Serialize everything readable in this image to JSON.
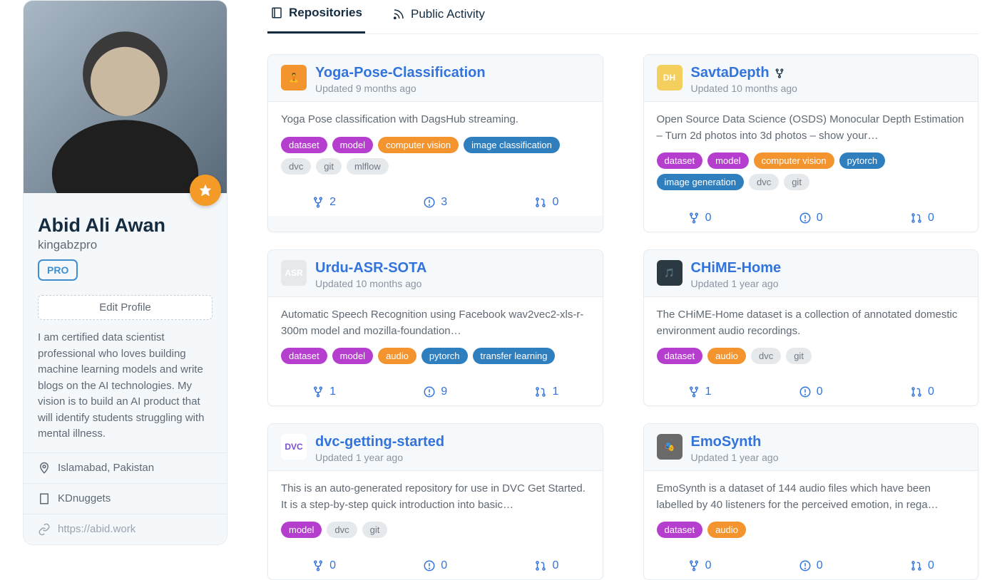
{
  "profile": {
    "name": "Abid Ali Awan",
    "username": "kingabzpro",
    "badge": "PRO",
    "edit_label": "Edit Profile",
    "bio": "I am certified data scientist professional who loves building machine learning models and write blogs on the AI technologies. My vision is to build an AI product that will identify students struggling with mental illness.",
    "location": "Islamabad, Pakistan",
    "org": "KDnuggets",
    "website": "https://abid.work"
  },
  "tabs": {
    "repositories": "Repositories",
    "activity": "Public Activity"
  },
  "tag_colors": {
    "dataset": "purple",
    "model": "purple",
    "computer vision": "orange",
    "image classification": "blue",
    "dvc": "grey",
    "git": "grey",
    "mlflow": "grey",
    "pytorch": "blue",
    "image generation": "blue",
    "audio": "orange",
    "transfer learning": "blue"
  },
  "repos": [
    {
      "title": "Yoga-Pose-Classification",
      "updated": "Updated 9 months ago",
      "fork": false,
      "icon_bg": "#f4942e",
      "icon_text": "🧘",
      "desc": "Yoga Pose classification with DagsHub streaming.",
      "tags": [
        "dataset",
        "model",
        "computer vision",
        "image classification",
        "dvc",
        "git",
        "mlflow"
      ],
      "stats": {
        "forks": "2",
        "issues": "3",
        "prs": "0"
      }
    },
    {
      "title": "SavtaDepth",
      "updated": "Updated 10 months ago",
      "fork": true,
      "icon_bg": "#f4cf5e",
      "icon_text": "DH",
      "desc": "Open Source Data Science (OSDS) Monocular Depth Estimation – Turn 2d photos into 3d photos – show your…",
      "tags": [
        "dataset",
        "model",
        "computer vision",
        "pytorch",
        "image generation",
        "dvc",
        "git"
      ],
      "stats": {
        "forks": "0",
        "issues": "0",
        "prs": "0"
      }
    },
    {
      "title": "Urdu-ASR-SOTA",
      "updated": "Updated 10 months ago",
      "fork": false,
      "icon_bg": "#e6e9ec",
      "icon_text": "ASR",
      "desc": "Automatic Speech Recognition using Facebook wav2vec2-xls-r-300m model and mozilla-foundation…",
      "tags": [
        "dataset",
        "model",
        "audio",
        "pytorch",
        "transfer learning"
      ],
      "stats": {
        "forks": "1",
        "issues": "9",
        "prs": "1"
      }
    },
    {
      "title": "CHiME-Home",
      "updated": "Updated 1 year ago",
      "fork": false,
      "icon_bg": "#2b3a42",
      "icon_text": "🎵",
      "desc": "The CHiME-Home dataset is a collection of annotated domestic environment audio recordings.",
      "tags": [
        "dataset",
        "audio",
        "dvc",
        "git"
      ],
      "stats": {
        "forks": "1",
        "issues": "0",
        "prs": "0"
      }
    },
    {
      "title": "dvc-getting-started",
      "updated": "Updated 1 year ago",
      "fork": false,
      "icon_bg": "#fff",
      "icon_text": "DVC",
      "desc": "This is an auto-generated repository for use in DVC Get Started. It is a step-by-step quick introduction into basic…",
      "tags": [
        "model",
        "dvc",
        "git"
      ],
      "stats": {
        "forks": "0",
        "issues": "0",
        "prs": "0"
      }
    },
    {
      "title": "EmoSynth",
      "updated": "Updated 1 year ago",
      "fork": false,
      "icon_bg": "#6a6a6a",
      "icon_text": "🎭",
      "desc": "EmoSynth is a dataset of 144 audio files which have been labelled by 40 listeners for the perceived emotion, in rega…",
      "tags": [
        "dataset",
        "audio"
      ],
      "stats": {
        "forks": "0",
        "issues": "0",
        "prs": "0"
      }
    }
  ]
}
